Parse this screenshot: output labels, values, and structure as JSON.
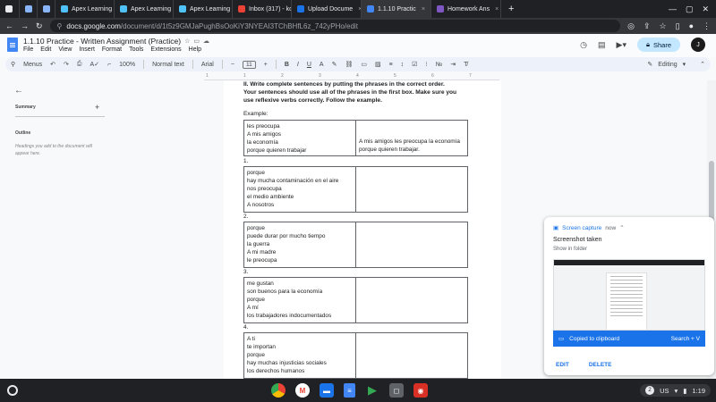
{
  "browser": {
    "tabs": [
      {
        "label": "",
        "icon": "docs-app-icon",
        "color": "#e8eaed",
        "active": false
      },
      {
        "label": "",
        "icon": "tab-globe-icon",
        "color": "#8ab4f8",
        "active": false
      },
      {
        "label": "",
        "icon": "tab-globe-icon",
        "color": "#8ab4f8",
        "active": false
      },
      {
        "label": "Apex Learning",
        "icon": "apex-icon",
        "color": "#4fc3f7",
        "active": false
      },
      {
        "label": "Apex Learning",
        "icon": "apex-icon",
        "color": "#4fc3f7",
        "active": false
      },
      {
        "label": "Apex Learning",
        "icon": "apex-icon",
        "color": "#4fc3f7",
        "active": false
      },
      {
        "label": "Inbox (317) - ko",
        "icon": "gmail-icon",
        "color": "#ea4335",
        "active": false
      },
      {
        "label": "Upload Docume",
        "icon": "upload-icon",
        "color": "#1a73e8",
        "active": false
      },
      {
        "label": "1.1.10 Practic",
        "icon": "docs-icon",
        "color": "#4285f4",
        "active": true
      },
      {
        "label": "Homework Ans",
        "icon": "homework-icon",
        "color": "#7e57c2",
        "active": false
      }
    ],
    "url_host": "docs.google.com",
    "url_path": "/document/d/1t5z9GMJaPughBsOoKiY3NYEAI3TChBHfL6z_742yPHo/edit"
  },
  "doc": {
    "title": "1.1.10 Practice - Written Assignment (Practice)",
    "menu": [
      "File",
      "Edit",
      "View",
      "Insert",
      "Format",
      "Tools",
      "Extensions",
      "Help"
    ],
    "share_label": "Share",
    "avatar_letter": "J"
  },
  "toolbar": {
    "menus_label": "Menus",
    "zoom": "100%",
    "style": "Normal text",
    "font": "Arial",
    "font_size": "11",
    "mode": "Editing"
  },
  "ruler_marks": [
    "1",
    "1",
    "2",
    "3",
    "4",
    "5",
    "6",
    "7"
  ],
  "outline": {
    "summary_label": "Summary",
    "outline_label": "Outline",
    "note": "Headings you add to the document will appear here."
  },
  "content": {
    "instructions": "II. Write complete sentences by putting the phrases in the correct order. Your sentences should use all of the phrases in the first box. Make sure you use reflexive verbs correctly. Follow the example.",
    "example_label": "Example:",
    "example_left": [
      "les preocupa",
      "A mis amigos",
      "la economía",
      "porque quieren trabajar"
    ],
    "example_right": [
      "A mis amigos les preocupa la economía",
      "porque quieren trabajar."
    ],
    "items": [
      {
        "number": "1.",
        "phrases": [
          "porque",
          "hay mucha contaminación en el aire",
          "nos preocupa",
          "el medio ambiente",
          "A nosotros"
        ]
      },
      {
        "number": "2.",
        "phrases": [
          "porque",
          "puede durar por mucho tiempo",
          "la guerra",
          "A mi madre",
          "le preocupa"
        ]
      },
      {
        "number": "3.",
        "phrases": [
          "me gustan",
          "son buenos para la economía",
          "porque",
          "A mí",
          "los trabajadores indocumentados"
        ]
      },
      {
        "number": "4.",
        "phrases": [
          "A ti",
          "te importan",
          "porque",
          "hay muchas injusticias sociales",
          "los derechos humanos"
        ]
      }
    ]
  },
  "notification": {
    "source": "Screen capture",
    "time": "now",
    "title": "Screenshot taken",
    "subtitle": "Show in folder",
    "copied": "Copied to clipboard",
    "search": "Search + V",
    "edit": "EDIT",
    "delete": "DELETE"
  },
  "shelf": {
    "notif_count": "2",
    "locale": "US",
    "time": "1:19"
  }
}
